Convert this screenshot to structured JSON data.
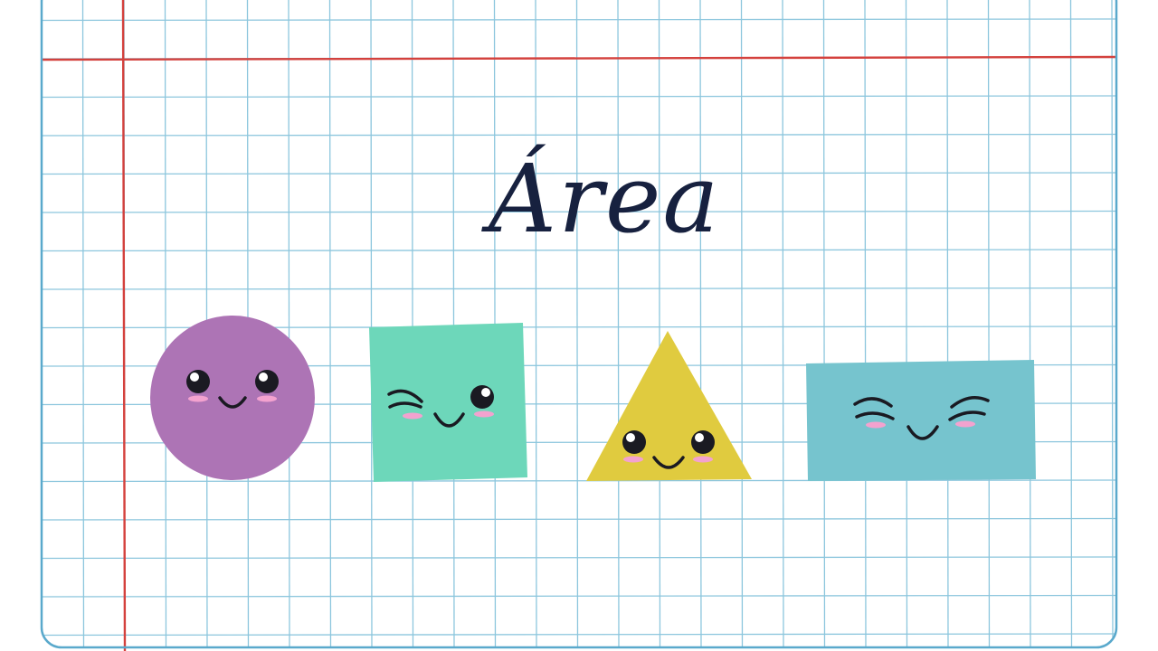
{
  "title": "Área",
  "colors": {
    "paper": "#ffffff",
    "grid": "#8cc6dd",
    "frame": "#5aa9cc",
    "margin_line": "#d4413d",
    "title_text": "#17213f",
    "circle": "#ad74b5",
    "square": "#6dd7ba",
    "triangle": "#e0cb3f",
    "rectangle": "#76c4ce",
    "eye": "#1a1a22",
    "blush": "#f3a2cf"
  },
  "shapes": [
    {
      "name": "circle",
      "expression": "smiling"
    },
    {
      "name": "square",
      "expression": "winking"
    },
    {
      "name": "triangle",
      "expression": "smiling"
    },
    {
      "name": "rectangle",
      "expression": "happy-closed-eyes"
    }
  ]
}
